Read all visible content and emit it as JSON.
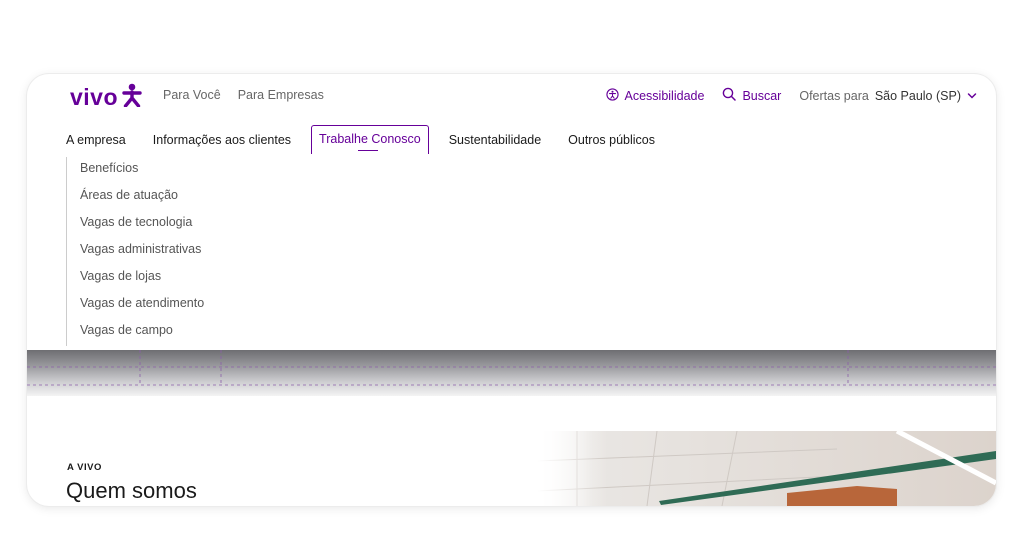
{
  "brand": {
    "logo_text": "vivo",
    "color": "#660099"
  },
  "top_nav": [
    "Para Você",
    "Para Empresas"
  ],
  "utility": {
    "accessibility_label": "Acessibilidade",
    "search_label": "Buscar",
    "offers_label": "Ofertas para",
    "city": "São Paulo (SP)"
  },
  "main_nav": {
    "items": [
      "A empresa",
      "Informações aos clientes",
      "Trabalhe Conosco",
      "Sustentabilidade",
      "Outros públicos"
    ],
    "active": "Trabalhe Conosco"
  },
  "submenu": [
    "Benefícios",
    "Áreas de atuação",
    "Vagas de tecnologia",
    "Vagas administrativas",
    "Vagas de lojas",
    "Vagas de atendimento",
    "Vagas de campo"
  ],
  "section": {
    "eyebrow": "A VIVO",
    "title": "Quem somos"
  },
  "icons": [
    "vivo-figure-icon",
    "accessibility-icon",
    "search-icon",
    "chevron-down-icon"
  ]
}
